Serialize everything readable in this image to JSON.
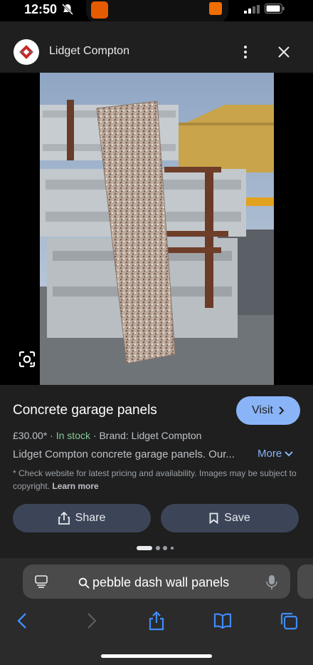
{
  "status": {
    "time": "12:50"
  },
  "header": {
    "site_name": "Lidget Compton"
  },
  "product": {
    "title": "Concrete garage panels",
    "visit_label": "Visit",
    "price": "£30.00*",
    "sep1": "·",
    "stock": "In stock",
    "sep2": "·",
    "brand": "Brand: Lidget Compton",
    "description": "Lidget Compton concrete garage panels. Our...",
    "more_label": "More",
    "disclaimer": "* Check website for latest pricing and availability. Images may be subject to copyright.",
    "learn_more": "Learn more",
    "share_label": "Share",
    "save_label": "Save"
  },
  "browser": {
    "query": "pebble dash wall panels"
  },
  "colors": {
    "accent": "#8ab4f8",
    "stock": "#81c995",
    "button_bg": "#3c4558"
  },
  "icons": [
    "bell-slash-icon",
    "app-icon",
    "shopping-bag-icon",
    "signal-icon",
    "battery-icon",
    "site-logo",
    "more-vert-icon",
    "close-icon",
    "lens-icon",
    "chevron-right-icon",
    "chevron-down-icon",
    "share-icon",
    "bookmark-icon",
    "tabs-icon",
    "search-icon",
    "mic-icon",
    "back-icon",
    "forward-icon",
    "share-sheet-icon",
    "bookmarks-icon",
    "tabs-overview-icon"
  ]
}
